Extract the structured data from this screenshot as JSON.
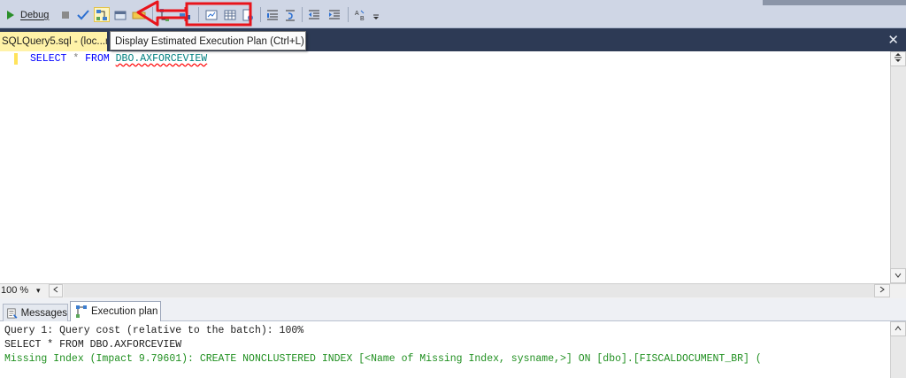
{
  "toolbar": {
    "debug_label": "Debug",
    "icons": [
      "execute-icon",
      "stop-icon",
      "parse-icon",
      "display-estimated-plan-icon",
      "query-designer-icon",
      "intellisense-icon",
      "include-actual-plan-icon",
      "live-stats-icon",
      "client-stats-icon",
      "results-to-text-icon",
      "results-to-grid-icon",
      "results-to-file-icon",
      "comment-icon",
      "uncomment-icon",
      "decrease-indent-icon",
      "increase-indent-icon",
      "specify-values-icon"
    ]
  },
  "document_tab": {
    "title": "SQLQuery5.sql - (loc...ro",
    "close_glyph": "✕"
  },
  "tooltip": {
    "text": "Display Estimated Execution Plan (Ctrl+L)"
  },
  "editor": {
    "keyword_select": "SELECT",
    "star": "*",
    "keyword_from": "FROM",
    "object": "DBO.AXFORCEVIEW"
  },
  "zoom": {
    "value": "100 %"
  },
  "result_tabs": [
    {
      "label": "Messages"
    },
    {
      "label": "Execution plan"
    }
  ],
  "results": {
    "line1": "Query 1: Query cost (relative to the batch): 100%",
    "line2": "SELECT * FROM DBO.AXFORCEVIEW",
    "line3": "Missing Index (Impact 9.79601): CREATE NONCLUSTERED INDEX [<Name of Missing Index, sysname,>] ON [dbo].[FISCALDOCUMENT_BR] ("
  },
  "colors": {
    "keyword": "#0000ff",
    "object": "#008080",
    "missing_index": "#1f8f1f",
    "annotation": "#e8141b",
    "tab_strip": "#2d3a55",
    "active_tab": "#fff2a8"
  }
}
